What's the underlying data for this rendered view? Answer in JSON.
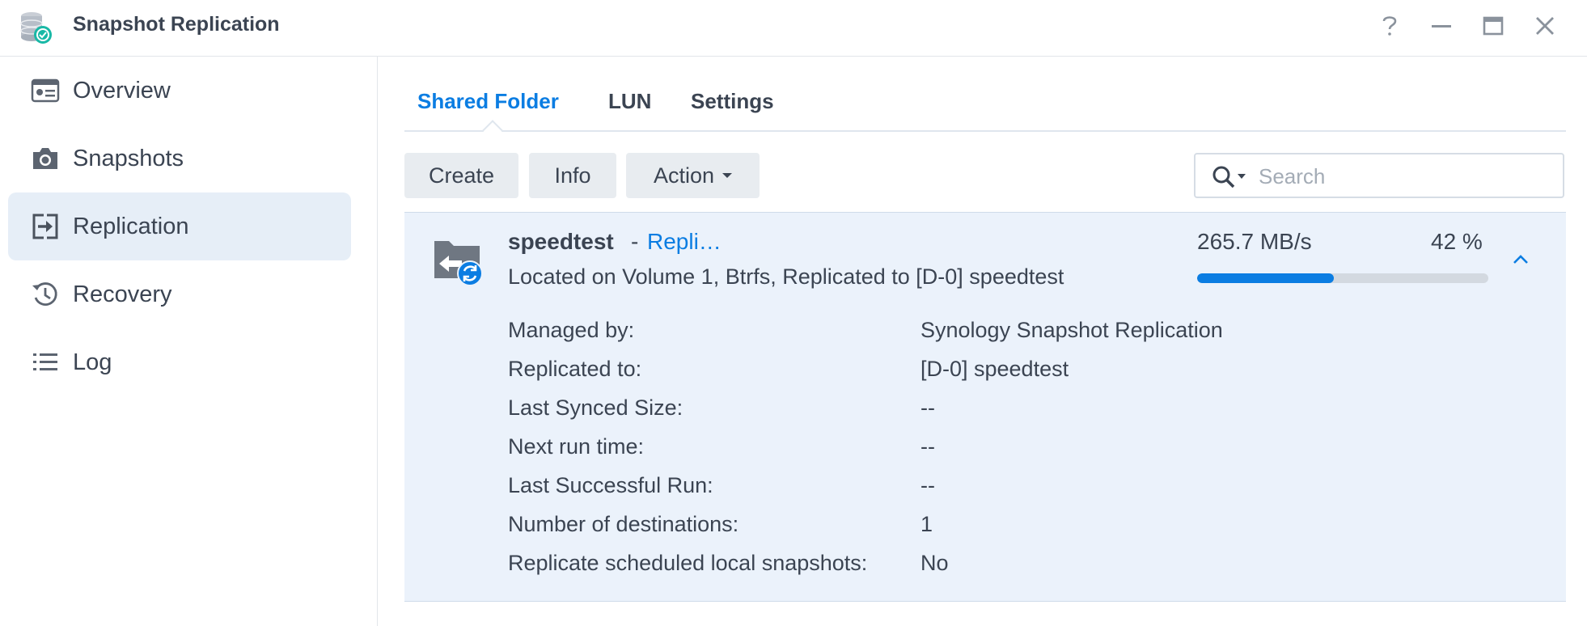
{
  "window": {
    "title": "Snapshot Replication",
    "icon": "app-database-clock-icon"
  },
  "sidebar": {
    "items": [
      {
        "label": "Overview",
        "icon": "overview-card-icon",
        "active": false
      },
      {
        "label": "Snapshots",
        "icon": "camera-icon",
        "active": false
      },
      {
        "label": "Replication",
        "icon": "replication-arrow-icon",
        "active": true
      },
      {
        "label": "Recovery",
        "icon": "history-clock-icon",
        "active": false
      },
      {
        "label": "Log",
        "icon": "list-icon",
        "active": false
      }
    ]
  },
  "tabs": [
    {
      "label": "Shared Folder",
      "active": true
    },
    {
      "label": "LUN",
      "active": false
    },
    {
      "label": "Settings",
      "active": false
    }
  ],
  "toolbar": {
    "create_label": "Create",
    "info_label": "Info",
    "action_label": "Action"
  },
  "search": {
    "placeholder": "Search",
    "value": ""
  },
  "item": {
    "name": "speedtest",
    "separator": "-",
    "status": "Repli…",
    "location": "Located on Volume 1, Btrfs, Replicated to [D-0] speedtest",
    "speed": "265.7 MB/s",
    "percent_text": "42 %",
    "progress": 0.47
  },
  "details": [
    {
      "label": "Managed by:",
      "value": "Synology Snapshot Replication"
    },
    {
      "label": "Replicated to:",
      "value": "[D-0] speedtest"
    },
    {
      "label": "Last Synced Size:",
      "value": "--"
    },
    {
      "label": "Next run time:",
      "value": "--"
    },
    {
      "label": "Last Successful Run:",
      "value": "--"
    },
    {
      "label": "Number of destinations:",
      "value": "1"
    },
    {
      "label": "Replicate scheduled local snapshots:",
      "value": "No"
    }
  ],
  "colors": {
    "accent": "#0b7de2",
    "active_nav_bg": "#e6eef7",
    "panel_bg": "#ebf2fb",
    "text": "#3b4452"
  }
}
